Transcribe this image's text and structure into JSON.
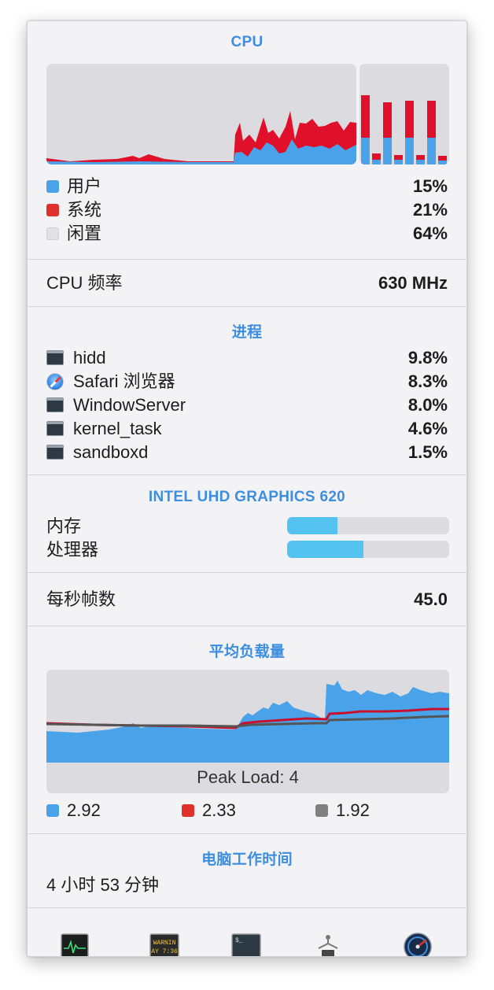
{
  "cpu": {
    "title": "CPU",
    "legend": [
      {
        "label": "用户",
        "value": "15%",
        "color": "#4aa3e8"
      },
      {
        "label": "系统",
        "value": "21%",
        "color": "#e0302c"
      },
      {
        "label": "闲置",
        "value": "64%",
        "color": "#e2e2e4"
      }
    ],
    "frequency_label": "CPU 频率",
    "frequency_value": "630 MHz"
  },
  "processes": {
    "title": "进程",
    "items": [
      {
        "name": "hidd",
        "value": "9.8%",
        "icon": "terminal-icon"
      },
      {
        "name": "Safari 浏览器",
        "value": "8.3%",
        "icon": "safari-icon"
      },
      {
        "name": "WindowServer",
        "value": "8.0%",
        "icon": "terminal-icon"
      },
      {
        "name": "kernel_task",
        "value": "4.6%",
        "icon": "terminal-icon"
      },
      {
        "name": "sandboxd",
        "value": "1.5%",
        "icon": "terminal-icon"
      }
    ]
  },
  "gpu": {
    "title": "INTEL UHD GRAPHICS 620",
    "memory_label": "内存",
    "memory_level": 0.31,
    "processor_label": "处理器",
    "processor_level": 0.47,
    "fps_label": "每秒帧数",
    "fps_value": "45.0"
  },
  "load": {
    "title": "平均负载量",
    "peak_text": "Peak Load: 4",
    "averages": [
      {
        "value": "2.92",
        "color": "#4aa3e8"
      },
      {
        "value": "2.33",
        "color": "#e0302c"
      },
      {
        "value": "1.92",
        "color": "#808080"
      }
    ]
  },
  "uptime": {
    "title": "电脑工作时间",
    "value": "4 小时 53 分钟"
  },
  "toolbar": {
    "buttons": [
      {
        "name": "activity-monitor-icon"
      },
      {
        "name": "console-icon",
        "text_top": "WARNIN",
        "text_bottom": "AY 7:36"
      },
      {
        "name": "terminal-icon"
      },
      {
        "name": "system-information-icon"
      },
      {
        "name": "disk-utility-icon"
      }
    ]
  }
}
